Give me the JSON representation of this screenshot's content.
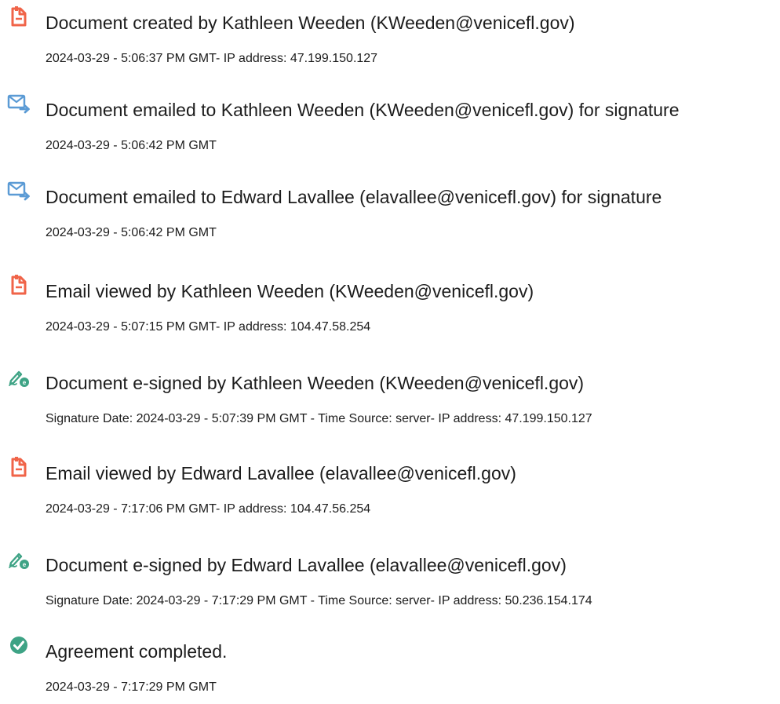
{
  "colors": {
    "doc_icon": "#f06449",
    "mail_icon": "#5b9bd5",
    "sign_icon": "#3ea385",
    "check_icon": "#3ea385"
  },
  "events": [
    {
      "icon": "document-icon",
      "title": "Document created by Kathleen Weeden (KWeeden@venicefl.gov)",
      "detail": "2024-03-29 - 5:06:37 PM GMT- IP address: 47.199.150.127"
    },
    {
      "icon": "email-sent-icon",
      "title": "Document emailed to Kathleen Weeden (KWeeden@venicefl.gov) for signature",
      "detail": "2024-03-29 - 5:06:42 PM GMT"
    },
    {
      "icon": "email-sent-icon",
      "title": "Document emailed to Edward Lavallee (elavallee@venicefl.gov) for signature",
      "detail": "2024-03-29 - 5:06:42 PM GMT"
    },
    {
      "icon": "document-icon",
      "title": "Email viewed by Kathleen Weeden (KWeeden@venicefl.gov)",
      "detail": "2024-03-29 - 5:07:15 PM GMT- IP address: 104.47.58.254"
    },
    {
      "icon": "e-sign-icon",
      "title": "Document e-signed by Kathleen Weeden (KWeeden@venicefl.gov)",
      "detail": "Signature Date: 2024-03-29 - 5:07:39 PM GMT - Time Source: server- IP address: 47.199.150.127"
    },
    {
      "icon": "document-icon",
      "title": "Email viewed by Edward Lavallee (elavallee@venicefl.gov)",
      "detail": "2024-03-29 - 7:17:06 PM GMT- IP address: 104.47.56.254"
    },
    {
      "icon": "e-sign-icon",
      "title": "Document e-signed by Edward Lavallee (elavallee@venicefl.gov)",
      "detail": "Signature Date: 2024-03-29 - 7:17:29 PM GMT - Time Source: server- IP address: 50.236.154.174"
    },
    {
      "icon": "check-circle-icon",
      "title": "Agreement completed.",
      "detail": "2024-03-29 - 7:17:29 PM GMT"
    }
  ]
}
